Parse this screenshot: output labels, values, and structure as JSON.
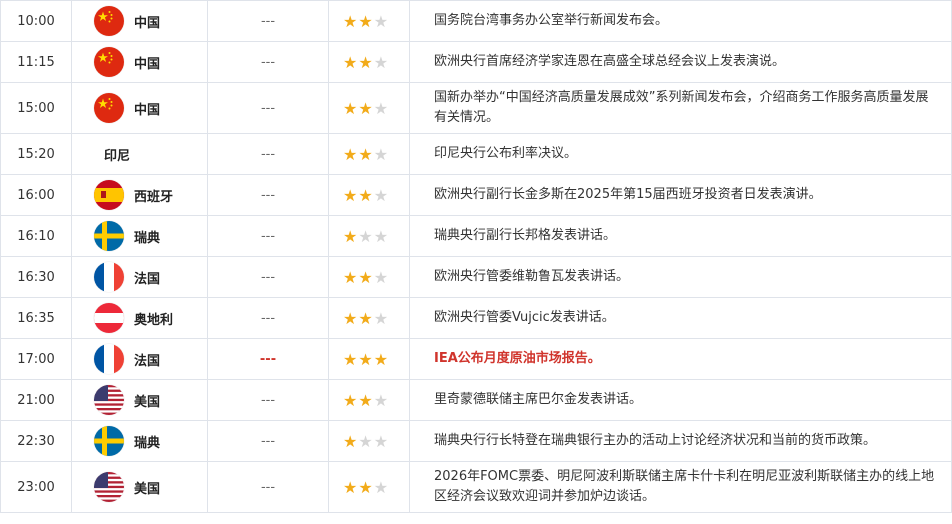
{
  "rows": [
    {
      "time": "10:00",
      "country": "中国",
      "flag": "cn",
      "previous": "---",
      "stars": 2,
      "event": "国务院台湾事务办公室举行新闻发布会。",
      "highlight": false
    },
    {
      "time": "11:15",
      "country": "中国",
      "flag": "cn",
      "previous": "---",
      "stars": 2,
      "event": "欧洲央行首席经济学家连恩在高盛全球总经会议上发表演说。",
      "highlight": false
    },
    {
      "time": "15:00",
      "country": "中国",
      "flag": "cn",
      "previous": "---",
      "stars": 2,
      "event": "国新办举办“中国经济高质量发展成效”系列新闻发布会，介绍商务工作服务高质量发展有关情况。",
      "highlight": false
    },
    {
      "time": "15:20",
      "country": "印尼",
      "flag": "",
      "previous": "---",
      "stars": 2,
      "event": "印尼央行公布利率决议。",
      "highlight": false
    },
    {
      "time": "16:00",
      "country": "西班牙",
      "flag": "es",
      "previous": "---",
      "stars": 2,
      "event": "欧洲央行副行长金多斯在2025年第15届西班牙投资者日发表演讲。",
      "highlight": false
    },
    {
      "time": "16:10",
      "country": "瑞典",
      "flag": "se",
      "previous": "---",
      "stars": 1,
      "event": "瑞典央行副行长邦格发表讲话。",
      "highlight": false
    },
    {
      "time": "16:30",
      "country": "法国",
      "flag": "fr",
      "previous": "---",
      "stars": 2,
      "event": "欧洲央行管委维勒鲁瓦发表讲话。",
      "highlight": false
    },
    {
      "time": "16:35",
      "country": "奥地利",
      "flag": "at",
      "previous": "---",
      "stars": 2,
      "event": "欧洲央行管委Vujcic发表讲话。",
      "highlight": false
    },
    {
      "time": "17:00",
      "country": "法国",
      "flag": "fr",
      "previous": "---",
      "stars": 3,
      "event": "IEA公布月度原油市场报告。",
      "highlight": true
    },
    {
      "time": "21:00",
      "country": "美国",
      "flag": "us",
      "previous": "---",
      "stars": 2,
      "event": "里奇蒙德联储主席巴尔金发表讲话。",
      "highlight": false
    },
    {
      "time": "22:30",
      "country": "瑞典",
      "flag": "se",
      "previous": "---",
      "stars": 1,
      "event": "瑞典央行行长特登在瑞典银行主办的活动上讨论经济状况和当前的货币政策。",
      "highlight": false
    },
    {
      "time": "23:00",
      "country": "美国",
      "flag": "us",
      "previous": "---",
      "stars": 2,
      "event": "2026年FOMC票委、明尼阿波利斯联储主席卡什卡利在明尼亚波利斯联储主办的线上地区经济会议致欢迎词并参加炉边谈话。",
      "highlight": false
    }
  ],
  "colors": {
    "star_on": "#f2ab1a",
    "star_off": "#d5d5d5",
    "highlight": "#d0342c"
  }
}
